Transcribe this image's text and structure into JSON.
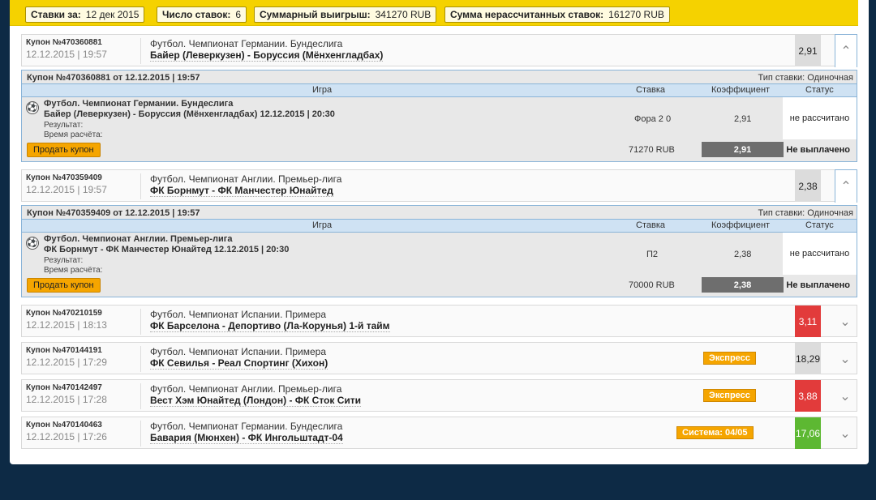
{
  "summary": {
    "bets_for_label": "Ставки за:",
    "bets_for_value": "12 дек 2015",
    "count_label": "Число ставок:",
    "count_value": "6",
    "win_label": "Суммарный выигрыш:",
    "win_value": "341270 RUB",
    "unsettled_label": "Сумма нерассчитанных ставок:",
    "unsettled_value": "161270 RUB"
  },
  "detail_headers": {
    "game": "Игра",
    "stake": "Ставка",
    "coef": "Коэффициент",
    "status": "Статус",
    "bet_type_prefix": "Тип ставки:",
    "result": "Результат:",
    "settle_time": "Время расчёта:",
    "sell": "Продать купон"
  },
  "coupons": [
    {
      "number": "Купон №470360881",
      "date": "12.12.2015 | 19:57",
      "league": "Футбол. Чемпионат Германии. Бундеслига",
      "match": "Байер (Леверкузен) - Боруссия (Мёнхенгладбах)",
      "coef": "2,91",
      "coef_color": "#dcdcdc",
      "expanded": true,
      "detail": {
        "title": "Купон №470360881 от 12.12.2015 | 19:57",
        "bet_type": "Тип ставки: Одиночная",
        "line1": "Футбол. Чемпионат Германии. Бундеслига",
        "line2": "Байер (Леверкузен) - Боруссия (Мёнхенгладбах) 12.12.2015 | 20:30",
        "stake": "Фора 2 0",
        "coef": "2,91",
        "status": "не рассчитано",
        "sum": "71270 RUB",
        "total_coef": "2,91",
        "payout": "Не выплачено"
      }
    },
    {
      "number": "Купон №470359409",
      "date": "12.12.2015 | 19:57",
      "league": "Футбол. Чемпионат Англии. Премьер-лига",
      "match": "ФК Борнмут - ФК Манчестер Юнайтед",
      "coef": "2,38",
      "coef_color": "#dcdcdc",
      "expanded": true,
      "detail": {
        "title": "Купон №470359409 от 12.12.2015 | 19:57",
        "bet_type": "Тип ставки: Одиночная",
        "line1": "Футбол. Чемпионат Англии. Премьер-лига",
        "line2": "ФК Борнмут - ФК Манчестер Юнайтед 12.12.2015 | 20:30",
        "stake": "П2",
        "coef": "2,38",
        "status": "не рассчитано",
        "sum": "70000 RUB",
        "total_coef": "2,38",
        "payout": "Не выплачено"
      }
    },
    {
      "number": "Купон №470210159",
      "date": "12.12.2015 | 18:13",
      "league": "Футбол. Чемпионат Испании. Примера",
      "match": "ФК Барселона - Депортиво (Ла-Корунья) 1-й тайм",
      "coef": "3,11",
      "coef_color": "#e23b3b"
    },
    {
      "number": "Купон №470144191",
      "date": "12.12.2015 | 17:29",
      "league": "Футбол. Чемпионат Испании. Примера",
      "match": "ФК Севилья - Реал Спортинг (Хихон)",
      "tag": "Экспресс",
      "coef": "18,29",
      "coef_color": "#dcdcdc"
    },
    {
      "number": "Купон №470142497",
      "date": "12.12.2015 | 17:28",
      "league": "Футбол. Чемпионат Англии. Премьер-лига",
      "match": "Вест Хэм Юнайтед (Лондон) - ФК Сток Сити",
      "tag": "Экспресс",
      "coef": "3,88",
      "coef_color": "#e23b3b"
    },
    {
      "number": "Купон №470140463",
      "date": "12.12.2015 | 17:26",
      "league": "Футбол. Чемпионат Германии. Бундеслига",
      "match": "Бавария (Мюнхен) - ФК Ингольштадт-04",
      "tag": "Система: 04/05",
      "coef": "17,06",
      "coef_color": "#5db832"
    }
  ]
}
